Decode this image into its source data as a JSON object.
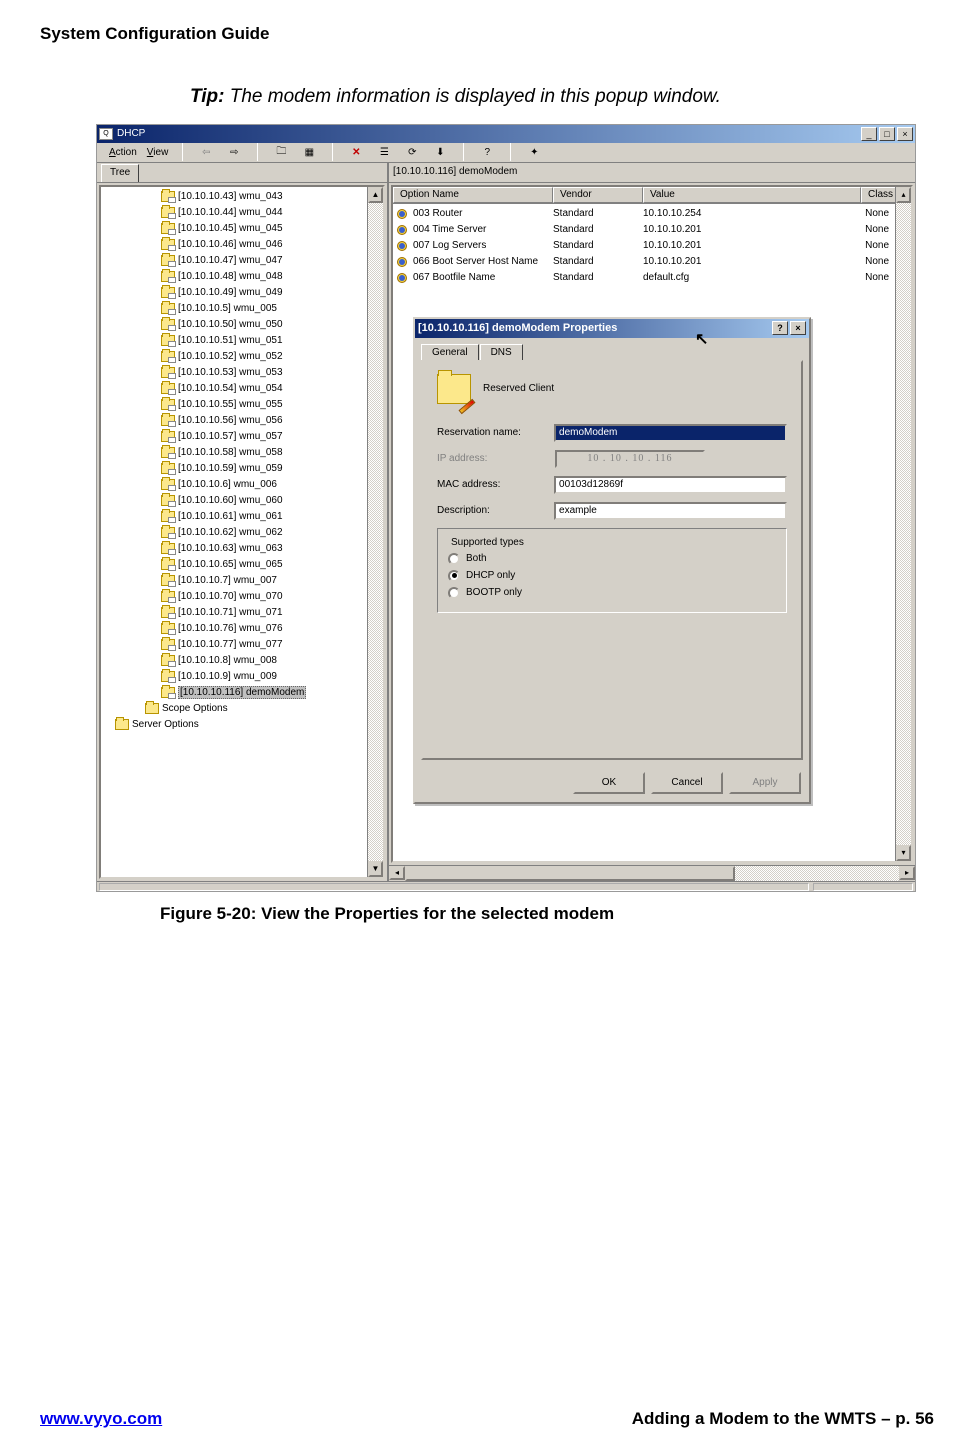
{
  "doc_header": "System Configuration Guide",
  "tip": {
    "label": "Tip:",
    "text": " The modem information is displayed in this popup window."
  },
  "window": {
    "title": "DHCP",
    "menus": {
      "action": "Action",
      "view": "View"
    },
    "tree_tab": "Tree",
    "tree_items": [
      "[10.10.10.43] wmu_043",
      "[10.10.10.44] wmu_044",
      "[10.10.10.45] wmu_045",
      "[10.10.10.46] wmu_046",
      "[10.10.10.47] wmu_047",
      "[10.10.10.48] wmu_048",
      "[10.10.10.49] wmu_049",
      "[10.10.10.5] wmu_005",
      "[10.10.10.50] wmu_050",
      "[10.10.10.51] wmu_051",
      "[10.10.10.52] wmu_052",
      "[10.10.10.53] wmu_053",
      "[10.10.10.54] wmu_054",
      "[10.10.10.55] wmu_055",
      "[10.10.10.56] wmu_056",
      "[10.10.10.57] wmu_057",
      "[10.10.10.58] wmu_058",
      "[10.10.10.59] wmu_059",
      "[10.10.10.6] wmu_006",
      "[10.10.10.60] wmu_060",
      "[10.10.10.61] wmu_061",
      "[10.10.10.62] wmu_062",
      "[10.10.10.63] wmu_063",
      "[10.10.10.65] wmu_065",
      "[10.10.10.7] wmu_007",
      "[10.10.10.70] wmu_070",
      "[10.10.10.71] wmu_071",
      "[10.10.10.76] wmu_076",
      "[10.10.10.77] wmu_077",
      "[10.10.10.8] wmu_008",
      "[10.10.10.9] wmu_009"
    ],
    "tree_selected": "[10.10.10.116] demoModem",
    "tree_extras": [
      "Scope Options",
      "Server Options"
    ],
    "path": "[10.10.10.116] demoModem",
    "columns": {
      "name": "Option Name",
      "vendor": "Vendor",
      "value": "Value",
      "class": "Class"
    },
    "rows": [
      {
        "name": "003 Router",
        "vendor": "Standard",
        "value": "10.10.10.254",
        "class": "None"
      },
      {
        "name": "004 Time Server",
        "vendor": "Standard",
        "value": "10.10.10.201",
        "class": "None"
      },
      {
        "name": "007 Log Servers",
        "vendor": "Standard",
        "value": "10.10.10.201",
        "class": "None"
      },
      {
        "name": "066 Boot Server Host Name",
        "vendor": "Standard",
        "value": "10.10.10.201",
        "class": "None"
      },
      {
        "name": "067 Bootfile Name",
        "vendor": "Standard",
        "value": "default.cfg",
        "class": "None"
      }
    ]
  },
  "dialog": {
    "title": "[10.10.10.116] demoModem Properties",
    "tabs": {
      "general": "General",
      "dns": "DNS"
    },
    "reserved_client": "Reserved Client",
    "labels": {
      "res_name": "Reservation name:",
      "ip": "IP address:",
      "mac": "MAC address:",
      "desc": "Description:",
      "supported": "Supported types"
    },
    "values": {
      "res_name": "demoModem",
      "ip": "10 . 10 . 10 . 116",
      "mac": "00103d12869f",
      "desc": "example"
    },
    "radios": {
      "both": "Both",
      "dhcp": "DHCP only",
      "bootp": "BOOTP only"
    },
    "buttons": {
      "ok": "OK",
      "cancel": "Cancel",
      "apply": "Apply"
    }
  },
  "caption": "Figure 5-20: View the Properties for the selected modem",
  "footer": {
    "url": "www.vyyo.com",
    "right": "Adding a Modem to the WMTS – p. 56"
  }
}
